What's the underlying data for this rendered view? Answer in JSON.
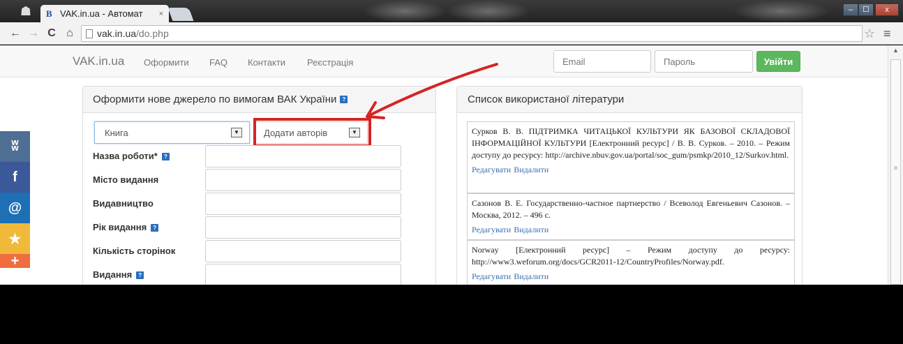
{
  "browser": {
    "tab_title": "VAK.in.ua - Автомат",
    "tab_favicon": "B",
    "tab_close": "×",
    "url_host": "vak.in.ua",
    "url_path": "/do.php",
    "win_min": "–",
    "win_max": "☐",
    "win_close": "x"
  },
  "site_nav": {
    "brand": "VAK.in.ua",
    "links": [
      "Оформити",
      "FAQ",
      "Контакти",
      "Реєстрація"
    ],
    "email_placeholder": "Email",
    "password_placeholder": "Пароль",
    "login_label": "Увійти",
    "login_color": "#5cb85c"
  },
  "form_panel": {
    "title": "Оформити нове джерело по вимогам ВАК України",
    "type_select": "Книга",
    "authors_select": "Додати авторів",
    "fields": [
      {
        "label": "Назва роботи*",
        "help": true
      },
      {
        "label": "Місто видання",
        "help": false
      },
      {
        "label": "Видавництво",
        "help": false
      },
      {
        "label": "Рік видання",
        "help": true
      },
      {
        "label": "Кількість сторінок",
        "help": false
      },
      {
        "label": "Видання",
        "help": true
      }
    ]
  },
  "references_panel": {
    "title": "Список використаної літератури",
    "edit_label": "Редагувати",
    "delete_label": "Видалити",
    "items": [
      "Сурков В. В. ПІДТРИМКА ЧИТАЦЬКОЇ КУЛЬТУРИ ЯК БАЗОВОЇ СКЛАДОВОЇ ІНФОРМАЦІЙНОЇ КУЛЬТУРИ [Електронний ресурс] / В. В. Сурков. – 2010. – Режим доступу до ресурсу: http://archive.nbuv.gov.ua/portal/soc_gum/psmkp/2010_12/Surkov.html.",
      "Сазонов В. Е. Государственно-частное партнерство / Всеволод Евгеньевич Сазонов. – Москва, 2012. – 496 с.",
      "Norway [Електронний ресурс] – Режим доступу до ресурсу: http://www3.weforum.org/docs/GCR2011-12/CountryProfiles/Norway.pdf."
    ]
  },
  "share_bar": [
    {
      "icon": "vk-icon",
      "glyph": "ʬ",
      "color": "#4e6e93"
    },
    {
      "icon": "facebook-icon",
      "glyph": "f",
      "color": "#3b5998"
    },
    {
      "icon": "mail-icon",
      "glyph": "@",
      "color": "#1f6fb5"
    },
    {
      "icon": "star-icon",
      "glyph": "★",
      "color": "#f0b93a"
    },
    {
      "icon": "plus-icon",
      "glyph": "+",
      "color": "#ef6d3f"
    }
  ],
  "annotation_color": "#d62424"
}
